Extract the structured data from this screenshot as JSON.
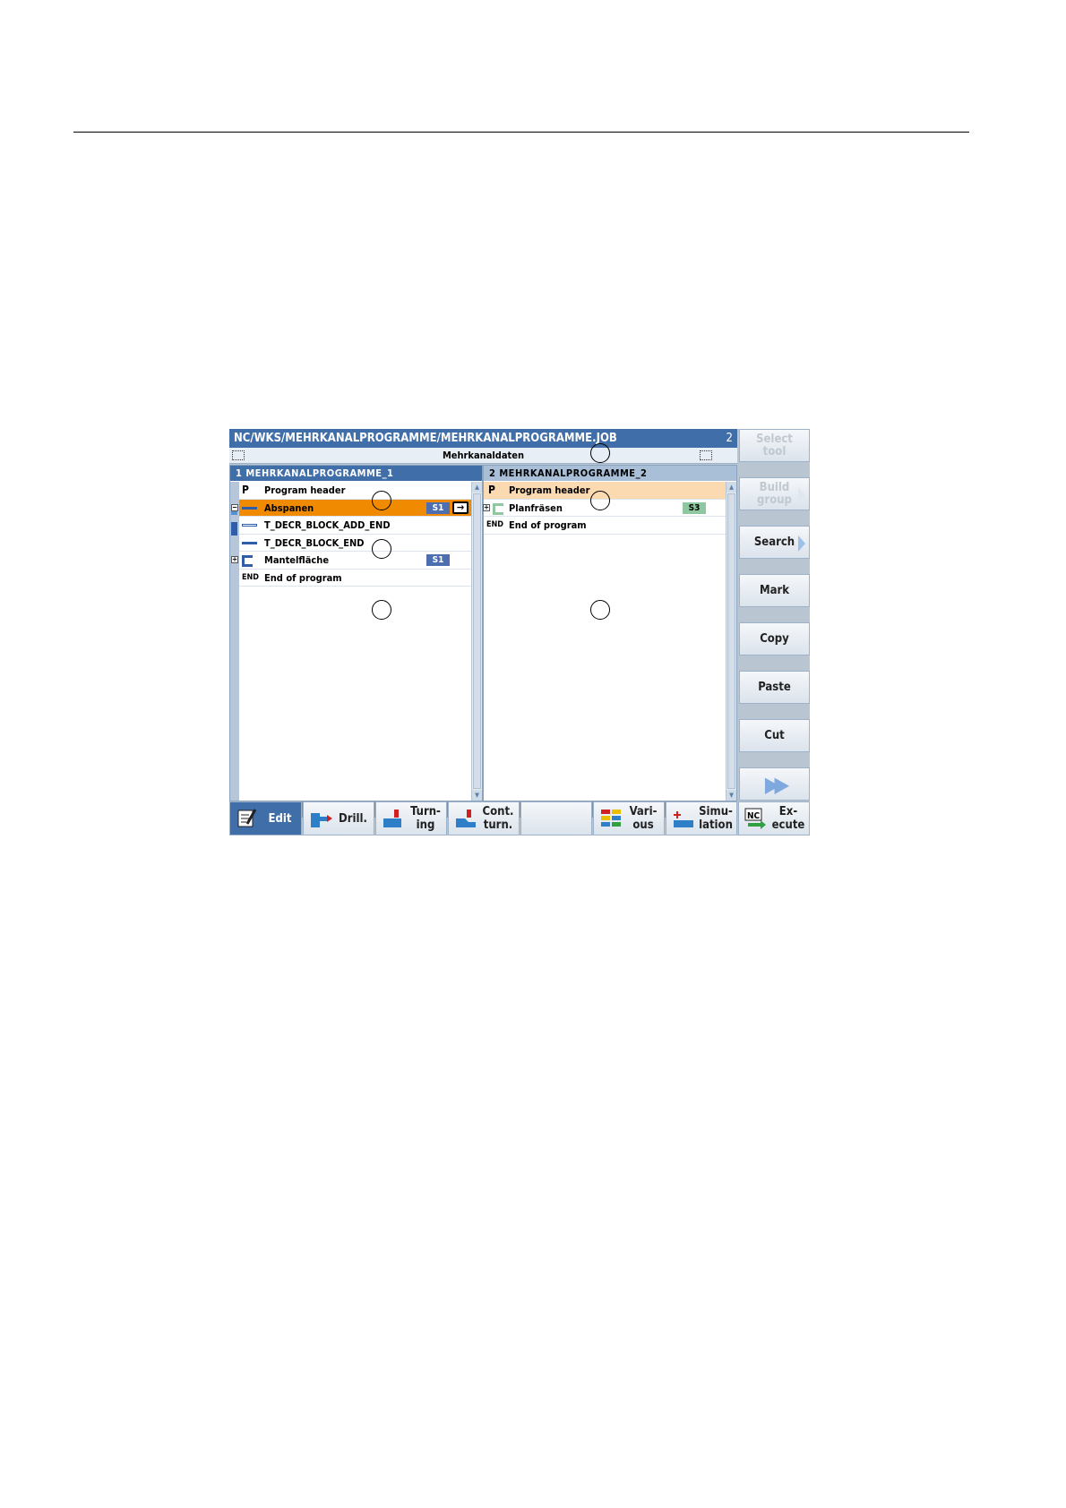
{
  "window": {
    "path": "NC/WKS/MEHRKANALPROGRAMME/MEHRKANALPROGRAMME.JOB",
    "channel_indicator": "2",
    "subtitle": "Mehrkanaldaten"
  },
  "pane1": {
    "header": "1 MEHRKANALPROGRAMME_1",
    "rows": [
      {
        "icon": "P",
        "label": "Program header"
      },
      {
        "icon": "bar",
        "label": "Abspanen",
        "badge": "S1"
      },
      {
        "icon": "bar-hollow",
        "label": "T_DECR_BLOCK_ADD_END"
      },
      {
        "icon": "bar",
        "label": "T_DECR_BLOCK_END"
      },
      {
        "icon": "bracket",
        "label": "Mantelfläche",
        "badge": "S1"
      },
      {
        "icon": "END",
        "label": "End of program"
      }
    ],
    "expand_minus": "−",
    "expand_plus": "+",
    "arrow_glyph": "→"
  },
  "pane2": {
    "header": "2 MEHRKANALPROGRAMME_2",
    "rows": [
      {
        "icon": "P",
        "label": "Program header"
      },
      {
        "icon": "bracket",
        "label": "Planfräsen",
        "badge": "S3"
      },
      {
        "icon": "END",
        "label": "End of program"
      }
    ],
    "expand_plus": "+"
  },
  "scroll": {
    "more": ">"
  },
  "vertical_softkeys": [
    {
      "label": "Select\ntool",
      "enabled": false
    },
    {
      "label": "Build\ngroup",
      "enabled": false
    },
    {
      "label": "Search",
      "enabled": true
    },
    {
      "label": "Mark",
      "enabled": true
    },
    {
      "label": "Copy",
      "enabled": true
    },
    {
      "label": "Paste",
      "enabled": true
    },
    {
      "label": "Cut",
      "enabled": true
    },
    {
      "label": "",
      "enabled": true
    }
  ],
  "horizontal_softkeys": [
    {
      "label": "Edit",
      "active": true
    },
    {
      "label": "Drill.",
      "active": false
    },
    {
      "label": "Turn-\ning",
      "active": false
    },
    {
      "label": "Cont.\nturn.",
      "active": false
    },
    {
      "label": "",
      "active": false
    },
    {
      "label": "Vari-\nous",
      "active": false
    },
    {
      "label": "Simu-\nlation",
      "active": false
    },
    {
      "label": "Ex-\necute",
      "active": false
    }
  ],
  "icons": {
    "execute_nc": "NC"
  },
  "colors": {
    "title_blue": "#3f6ea8",
    "selection_orange": "#f08a00",
    "highlight_peach": "#fbd9b1",
    "badge_blue": "#4d6fb0",
    "badge_green": "#8fc8a0"
  }
}
